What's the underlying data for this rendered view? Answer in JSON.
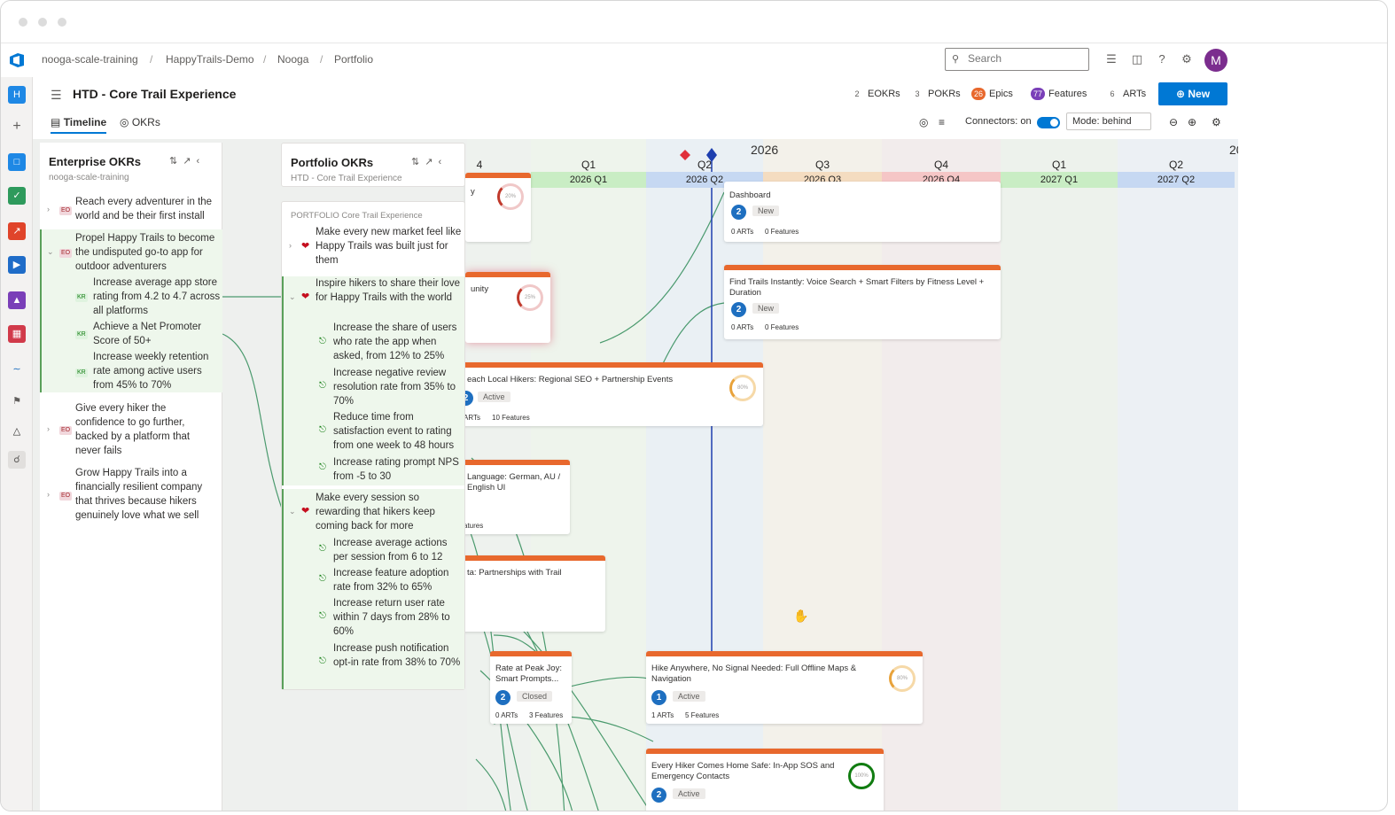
{
  "breadcrumb": [
    "nooga-scale-training",
    "HappyTrails-Demo",
    "Nooga",
    "Portfolio"
  ],
  "search": {
    "placeholder": "Search"
  },
  "user": {
    "initial": "M"
  },
  "page": {
    "title": "HTD - Core Trail Experience"
  },
  "tabs": [
    {
      "label": "Timeline"
    },
    {
      "label": "OKRs"
    }
  ],
  "stats": [
    {
      "count": "2",
      "label": "EOKRs"
    },
    {
      "count": "3",
      "label": "POKRs"
    },
    {
      "count": "26",
      "label": "Epics"
    },
    {
      "count": "77",
      "label": "Features"
    },
    {
      "count": "6",
      "label": "ARTs"
    }
  ],
  "new_button": "New",
  "toolbar": {
    "connectors": "Connectors: on",
    "mode": "Mode: behind"
  },
  "enterprise_panel": {
    "title": "Enterprise OKRs",
    "subtitle": "nooga-scale-training",
    "objectives": [
      {
        "tag": "EO",
        "text": "Reach every adventurer in the world and be their first install"
      },
      {
        "tag": "EO",
        "text": "Propel Happy Trails to become the undisputed go-to app for outdoor adventurers"
      },
      {
        "tag": "KR",
        "text": "Increase average app store rating from 4.2 to 4.7 across all platforms"
      },
      {
        "tag": "KR",
        "text": "Achieve a Net Promoter Score of 50+"
      },
      {
        "tag": "KR",
        "text": "Increase weekly retention rate among active users from 45% to 70%"
      },
      {
        "tag": "EO",
        "text": "Give every hiker the confidence to go further, backed by a platform that never fails"
      },
      {
        "tag": "EO",
        "text": "Grow Happy Trails into a financially resilient company that thrives because hikers genuinely love what we sell"
      }
    ]
  },
  "portfolio_panel": {
    "title": "Portfolio OKRs",
    "subtitle": "HTD - Core Trail Experience",
    "section": "PORTFOLIO Core Trail Experience",
    "items": [
      {
        "text": "Make every new market feel like Happy Trails was built just for them"
      },
      {
        "text": "Inspire hikers to share their love for Happy Trails with the world"
      },
      {
        "text": "Increase the share of users who rate the app when asked, from 12% to 25%"
      },
      {
        "text": "Increase negative review resolution rate from 35% to 70%"
      },
      {
        "text": "Reduce time from satisfaction event to rating from one week to 48 hours"
      },
      {
        "text": "Increase rating prompt NPS from -5 to 30"
      },
      {
        "text": "Make every session so rewarding that hikers keep coming back for more"
      },
      {
        "text": "Increase average actions per session from 6 to 12"
      },
      {
        "text": "Increase feature adoption rate from 32% to 65%"
      },
      {
        "text": "Increase return user rate within 7 days from 28% to 60%"
      },
      {
        "text": "Increase push notification opt-in rate from 38% to 70%"
      }
    ]
  },
  "timeline": {
    "year": "2026",
    "year_next": "20",
    "quarters": [
      {
        "q": "4",
        "band": ""
      },
      {
        "q": "Q1",
        "band": "2026 Q1"
      },
      {
        "q": "Q2",
        "band": "2026 Q2"
      },
      {
        "q": "Q3",
        "band": "2026 Q3"
      },
      {
        "q": "Q4",
        "band": "2026 Q4"
      },
      {
        "q": "Q1",
        "band": "2027 Q1"
      },
      {
        "q": "Q2",
        "band": "2027 Q2"
      }
    ]
  },
  "cards": [
    {
      "title": "Dashboard",
      "num": "2",
      "state": "New",
      "arts": "0 ARTs",
      "features": "0 Features"
    },
    {
      "title": "Find Trails Instantly: Voice Search + Smart Filters by Fitness Level + Duration",
      "num": "2",
      "state": "New",
      "arts": "0 ARTs",
      "features": "0 Features"
    },
    {
      "title": "each Local Hikers: Regional SEO + Partnership Events",
      "num": "2",
      "state": "Active",
      "arts": "ARTs",
      "features": "10 Features",
      "ring": "80%"
    },
    {
      "title": "Language: German, AU / English UI",
      "num": "",
      "state": "",
      "arts": "",
      "features": "atures"
    },
    {
      "title": "ta: Partnerships with Trail",
      "num": "",
      "state": "",
      "arts": "",
      "features": ""
    },
    {
      "title": "Rate at Peak Joy: Smart Prompts...",
      "num": "2",
      "state": "Closed",
      "arts": "0 ARTs",
      "features": "3 Features"
    },
    {
      "title": "Hike Anywhere, No Signal Needed: Full Offline Maps & Navigation",
      "num": "1",
      "state": "Active",
      "arts": "1 ARTs",
      "features": "5 Features",
      "ring": "80%"
    },
    {
      "title": "Every Hiker Comes Home Safe: In-App SOS and Emergency Contacts",
      "num": "2",
      "state": "Active",
      "arts": "",
      "features": "",
      "ring": "100%"
    },
    {
      "title": "unity",
      "num": "",
      "state": "",
      "arts": "",
      "features": "",
      "ring": "25%"
    },
    {
      "title": "y",
      "num": "",
      "state": "",
      "arts": "",
      "features": "",
      "ring": "20%"
    }
  ]
}
